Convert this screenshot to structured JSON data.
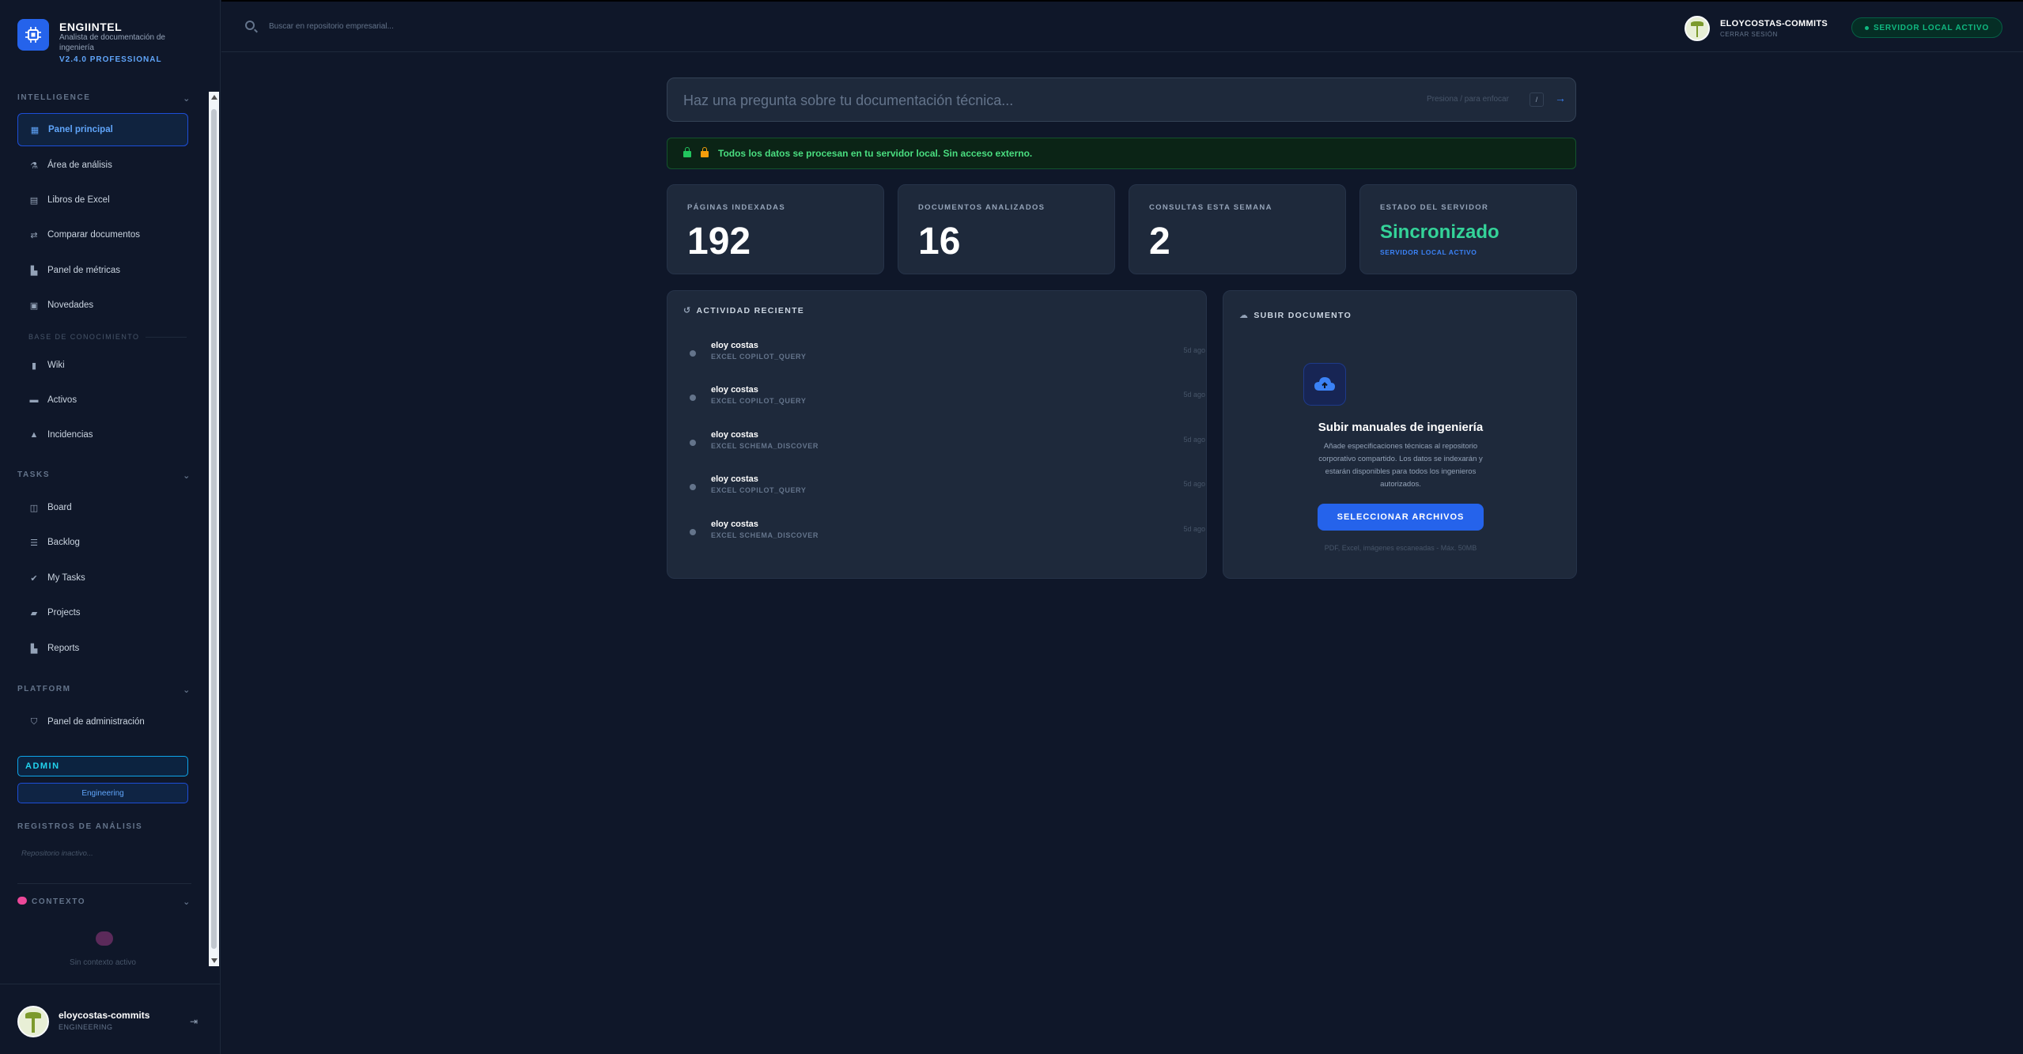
{
  "brand": {
    "name": "ENGIINTEL",
    "subtitle": "Analista de documentación de ingeniería",
    "version": "V2.4.0 PROFESSIONAL"
  },
  "sidebar": {
    "intelligence_title": "INTELLIGENCE",
    "intelligence_items": [
      {
        "label": "Panel principal",
        "icon": "grid-icon",
        "active": true
      },
      {
        "label": "Área de análisis",
        "icon": "flask-icon"
      },
      {
        "label": "Libros de Excel",
        "icon": "file-icon"
      },
      {
        "label": "Comparar documentos",
        "icon": "compare-icon"
      },
      {
        "label": "Panel de métricas",
        "icon": "chart-icon"
      },
      {
        "label": "Novedades",
        "icon": "news-icon"
      }
    ],
    "knowledge_title": "BASE DE CONOCIMIENTO",
    "knowledge_items": [
      {
        "label": "Wiki",
        "icon": "book-icon"
      },
      {
        "label": "Activos",
        "icon": "box-icon"
      },
      {
        "label": "Incidencias",
        "icon": "warning-icon"
      }
    ],
    "tasks_title": "TASKS",
    "tasks_items": [
      {
        "label": "Board",
        "icon": "board-icon"
      },
      {
        "label": "Backlog",
        "icon": "list-icon"
      },
      {
        "label": "My Tasks",
        "icon": "user-check-icon"
      },
      {
        "label": "Projects",
        "icon": "folder-icon"
      },
      {
        "label": "Reports",
        "icon": "chart-icon"
      }
    ],
    "platform_title": "PLATFORM",
    "platform_items": [
      {
        "label": "Panel de administración",
        "icon": "shield-icon"
      }
    ],
    "role_badge": "ADMIN",
    "team_badge": "Engineering",
    "logs_title": "REGISTROS DE ANÁLISIS",
    "logs_empty": "Repositorio inactivo...",
    "context_title": "CONTEXTO",
    "context_empty": "Sin contexto activo"
  },
  "footer_user": {
    "name": "eloycostas-commits",
    "role": "ENGINEERING"
  },
  "topbar": {
    "search_placeholder": "Buscar en repositorio empresarial...",
    "user": "ELOYCOSTAS-COMMITS",
    "logout": "CERRAR SESIÓN",
    "server_status": "SERVIDOR LOCAL ACTIVO"
  },
  "ask": {
    "placeholder": "Haz una pregunta sobre tu documentación técnica...",
    "hint": "Presiona / para enfocar",
    "key": "/"
  },
  "security_notice": "Todos los datos se procesan en tu servidor local. Sin acceso externo.",
  "stats": [
    {
      "label": "PÁGINAS INDEXADAS",
      "value": "192"
    },
    {
      "label": "DOCUMENTOS ANALIZADOS",
      "value": "16"
    },
    {
      "label": "CONSULTAS ESTA SEMANA",
      "value": "2"
    },
    {
      "label": "ESTADO DEL SERVIDOR",
      "value": "Sincronizado",
      "sub": "SERVIDOR LOCAL ACTIVO"
    }
  ],
  "activity": {
    "title": "ACTIVIDAD RECIENTE",
    "rows": [
      {
        "who": "eloy costas",
        "what": "EXCEL COPILOT_QUERY",
        "when": "5d ago"
      },
      {
        "who": "eloy costas",
        "what": "EXCEL COPILOT_QUERY",
        "when": "5d ago"
      },
      {
        "who": "eloy costas",
        "what": "EXCEL SCHEMA_DISCOVER",
        "when": "5d ago"
      },
      {
        "who": "eloy costas",
        "what": "EXCEL COPILOT_QUERY",
        "when": "5d ago"
      },
      {
        "who": "eloy costas",
        "what": "EXCEL SCHEMA_DISCOVER",
        "when": "5d ago"
      }
    ]
  },
  "upload": {
    "title": "SUBIR DOCUMENTO",
    "heading": "Subir manuales de ingeniería",
    "description": "Añade especificaciones técnicas al repositorio corporativo compartido. Los datos se indexarán y estarán disponibles para todos los ingenieros autorizados.",
    "button": "SELECCIONAR ARCHIVOS",
    "formats": "PDF, Excel, imágenes escaneadas - Máx. 50MB"
  },
  "colors": {
    "background": "#0f1729",
    "card": "#1e293b",
    "accent": "#2563eb",
    "success": "#34d399"
  }
}
